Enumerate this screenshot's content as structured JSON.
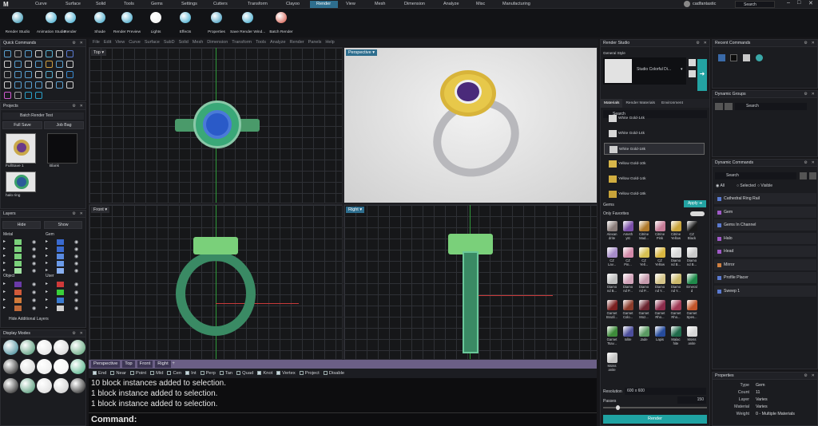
{
  "tabs": [
    "Curve",
    "Surface",
    "Solid",
    "Tools",
    "Gems",
    "Settings",
    "Cutters",
    "Transform",
    "Clayoo",
    "Render",
    "View",
    "Mesh",
    "Dimension",
    "Analyze",
    "Misc",
    "Manufacturing"
  ],
  "active_tab": "Render",
  "user": "cadfantastic",
  "search_placeholder": "Search",
  "ribbon": [
    "Render Studio",
    "Animation Studio",
    "Render",
    "Shade",
    "Render Preview",
    "Lights",
    "Effects",
    "Properties",
    "Save Render Wind...",
    "Batch Render"
  ],
  "menubar": [
    "File",
    "Edit",
    "View",
    "Curve",
    "Surface",
    "SubD",
    "Solid",
    "Mesh",
    "Dimension",
    "Transform",
    "Tools",
    "Analyze",
    "Render",
    "Panels",
    "Help"
  ],
  "quick_commands": {
    "title": "Quick Commands"
  },
  "projects": {
    "title": "Projects",
    "project_name": "Batch Render Test",
    "full_save": "Full Save",
    "job_bag": "Job Bag",
    "thumbs": [
      "FullSave 1",
      "Blank",
      "halo ring"
    ]
  },
  "layers": {
    "title": "Layers",
    "hide": "Hide",
    "show": "Show",
    "groups": [
      "Metal",
      "Gem",
      "Object",
      "User"
    ],
    "hide_additional": "Hide Additional Layers"
  },
  "display_modes": {
    "title": "Display Modes"
  },
  "viewports": {
    "top": "Top",
    "perspective": "Perspective",
    "front": "Front",
    "right": "Right"
  },
  "viewport_tabs": [
    "Perspective",
    "Top",
    "Front",
    "Right"
  ],
  "osnaps": [
    {
      "label": "End",
      "on": true
    },
    {
      "label": "Near",
      "on": false
    },
    {
      "label": "Point",
      "on": false
    },
    {
      "label": "Mid",
      "on": false
    },
    {
      "label": "Cen",
      "on": false
    },
    {
      "label": "Int",
      "on": true
    },
    {
      "label": "Perp",
      "on": false
    },
    {
      "label": "Tan",
      "on": false
    },
    {
      "label": "Quad",
      "on": false
    },
    {
      "label": "Knot",
      "on": true
    },
    {
      "label": "Vertex",
      "on": true
    },
    {
      "label": "Project",
      "on": false
    },
    {
      "label": "Disable",
      "on": false
    }
  ],
  "history": [
    "10 block instances added to selection.",
    "1 block instance added to selection.",
    "1 block instance added to selection."
  ],
  "command_label": "Command:",
  "render_studio": {
    "title": "Render Studio",
    "general_style": "General Style",
    "style_name": "Studio Colorful Di...",
    "tabs": [
      "Materials",
      "Render Materials",
      "Environment"
    ],
    "search": "Search",
    "materials": [
      "White Gold-14k",
      "White Gold-14k",
      "White Gold-18k",
      "Yellow Gold-10k",
      "Yellow Gold-14k",
      "Yellow Gold-18k"
    ],
    "gems_label": "Gems",
    "apply": "Apply",
    "only_favorites": "Only Favorites",
    "gems": [
      [
        "Alexan drite",
        "#8a7d7a"
      ],
      [
        "Ameth yst",
        "#7b4fa8"
      ],
      [
        "Citrine Mad...",
        "#b07a2c"
      ],
      [
        "Citrine Pink",
        "#c57b96"
      ],
      [
        "Citrine Yellow",
        "#c9a43a"
      ],
      [
        "CZ Black",
        "#1a1a1a"
      ],
      [
        "CZ Lav...",
        "#a68cc9"
      ],
      [
        "CZ Pin...",
        "#d38aa9"
      ],
      [
        "CZ Yell...",
        "#d7c052"
      ],
      [
        "CZ Yellow",
        "#d9b640"
      ],
      [
        "Diamo nd B...",
        "#d8d8d8"
      ],
      [
        "Diamo nd B...",
        "#c9c9c9"
      ],
      [
        "Diamo nd B...",
        "#bfbfbf"
      ],
      [
        "Diamo nd P...",
        "#d2a3b9"
      ],
      [
        "Diamo nd P...",
        "#c59aac"
      ],
      [
        "Diamo nd Y...",
        "#d5c58a"
      ],
      [
        "Diamo nd Y...",
        "#cbb96a"
      ],
      [
        "Emeral d",
        "#1f8a4a"
      ],
      [
        "Garnet Brazil...",
        "#7a2020"
      ],
      [
        "Garnet Colo...",
        "#8a3b2a"
      ],
      [
        "Garnet Moz...",
        "#6b2530"
      ],
      [
        "Garnet Rho...",
        "#8a2b4a"
      ],
      [
        "Garnet Rho...",
        "#a03a55"
      ],
      [
        "Garnet Spes...",
        "#c2552a"
      ],
      [
        "Garnet Tsav...",
        "#3d8a3a"
      ],
      [
        "Iolite",
        "#4c4e9c"
      ],
      [
        "Jade",
        "#5a9a62"
      ],
      [
        "Lapis",
        "#264b9c"
      ],
      [
        "Malac hite",
        "#1f6a4a"
      ],
      [
        "Moiss anite",
        "#d6d6d6"
      ],
      [
        "Moiss anite",
        "#c4c4c4"
      ]
    ],
    "resolution_label": "Resolution",
    "resolution": "600 x 600",
    "passes_label": "Passes",
    "passes": "150",
    "render": "Render"
  },
  "recent_commands": {
    "title": "Recent Commands"
  },
  "dynamic_groups": {
    "title": "Dynamic Groups",
    "search": "Search"
  },
  "dynamic_commands": {
    "title": "Dynamic Commands",
    "search": "Search",
    "filters": [
      "All",
      "Selected",
      "Visible"
    ],
    "items": [
      [
        "Cathedral Ring Rail",
        "#5a7ad0"
      ],
      [
        "Gem",
        "#a05ac8"
      ],
      [
        "Gems In Channel",
        "#5a7ad0"
      ],
      [
        "Halo",
        "#a05ac8"
      ],
      [
        "Head",
        "#a05ac8"
      ],
      [
        "Mirror",
        "#d08040"
      ],
      [
        "Profile Placer",
        "#5a7ad0"
      ],
      [
        "Sweep 1",
        "#5a7ad0"
      ]
    ]
  },
  "properties": {
    "title": "Properties",
    "rows": [
      [
        "Type",
        "Gem"
      ],
      [
        "Count",
        "11"
      ],
      [
        "Layer",
        "Varies"
      ],
      [
        "Material",
        "Varies"
      ],
      [
        "Weight",
        "0 - Multiple Materials"
      ]
    ]
  }
}
